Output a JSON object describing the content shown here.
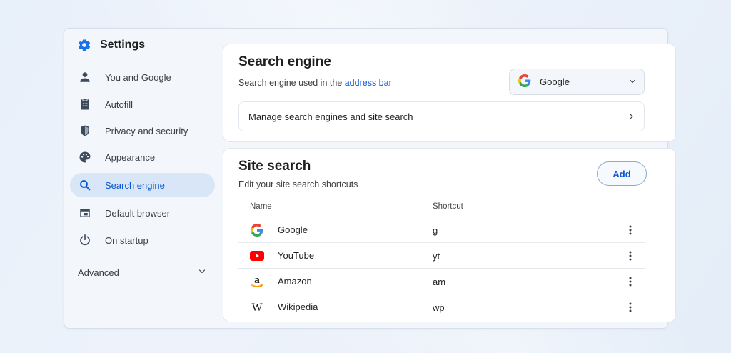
{
  "sidebar": {
    "title": "Settings",
    "items": [
      {
        "label": "You and Google",
        "icon": "person-icon"
      },
      {
        "label": "Autofill",
        "icon": "clipboard-icon"
      },
      {
        "label": "Privacy and security",
        "icon": "shield-icon"
      },
      {
        "label": "Appearance",
        "icon": "palette-icon"
      },
      {
        "label": "Search engine",
        "icon": "search-icon",
        "active": true
      },
      {
        "label": "Default browser",
        "icon": "browser-icon"
      },
      {
        "label": "On startup",
        "icon": "power-icon"
      }
    ],
    "advanced_label": "Advanced"
  },
  "search_engine": {
    "title": "Search engine",
    "subtitle_prefix": "Search engine used in the",
    "subtitle_link": "address bar",
    "selected_engine": "Google",
    "manage_label": "Manage search engines and site search"
  },
  "site_search": {
    "title": "Site search",
    "subtitle": "Edit your site search shortcuts",
    "add_label": "Add",
    "columns": {
      "name": "Name",
      "shortcut": "Shortcut"
    },
    "rows": [
      {
        "name": "Google",
        "shortcut": "g",
        "logo": "google-logo-icon"
      },
      {
        "name": "YouTube",
        "shortcut": "yt",
        "logo": "youtube-logo-icon"
      },
      {
        "name": "Amazon",
        "shortcut": "am",
        "logo": "amazon-logo-icon"
      },
      {
        "name": "Wikipedia",
        "shortcut": "wp",
        "logo": "wikipedia-logo-icon"
      }
    ]
  },
  "colors": {
    "accent": "#0b57d0",
    "active_bg": "#d8e6f8",
    "icon": "#3c4a5c"
  }
}
